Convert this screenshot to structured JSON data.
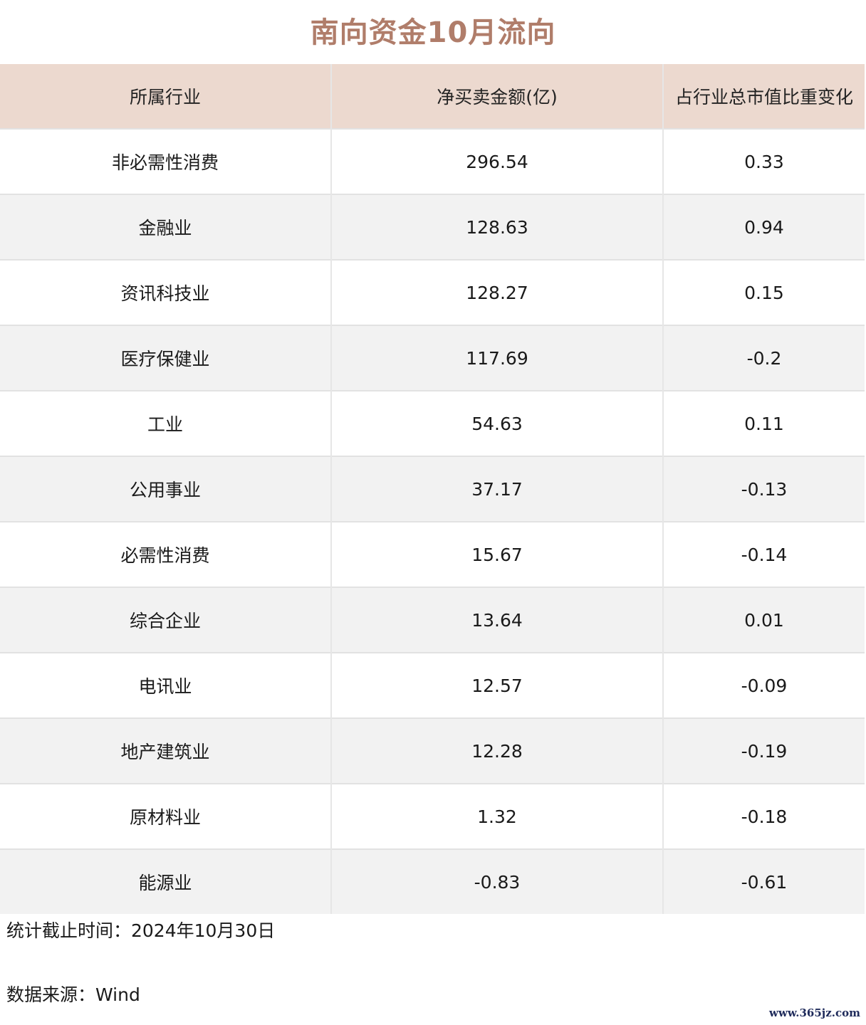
{
  "title": "南向资金10月流向",
  "headers": [
    "所属行业",
    "净买卖金额(亿)",
    "占行业总市值比重变化"
  ],
  "rows": [
    {
      "industry": "非必需性消费",
      "net": "296.54",
      "change": "0.33"
    },
    {
      "industry": "金融业",
      "net": "128.63",
      "change": "0.94"
    },
    {
      "industry": "资讯科技业",
      "net": "128.27",
      "change": "0.15"
    },
    {
      "industry": "医疗保健业",
      "net": "117.69",
      "change": "-0.2"
    },
    {
      "industry": "工业",
      "net": "54.63",
      "change": "0.11"
    },
    {
      "industry": "公用事业",
      "net": "37.17",
      "change": "-0.13"
    },
    {
      "industry": "必需性消费",
      "net": "15.67",
      "change": "-0.14"
    },
    {
      "industry": "综合企业",
      "net": "13.64",
      "change": "0.01"
    },
    {
      "industry": "电讯业",
      "net": "12.57",
      "change": "-0.09"
    },
    {
      "industry": "地产建筑业",
      "net": "12.28",
      "change": "-0.19"
    },
    {
      "industry": "原材料业",
      "net": "1.32",
      "change": "-0.18"
    },
    {
      "industry": "能源业",
      "net": "-0.83",
      "change": "-0.61"
    }
  ],
  "footnotes": {
    "date": "统计截止时间：2024年10月30日",
    "source": "数据来源：Wind"
  },
  "watermark": "www.365jz.com"
}
